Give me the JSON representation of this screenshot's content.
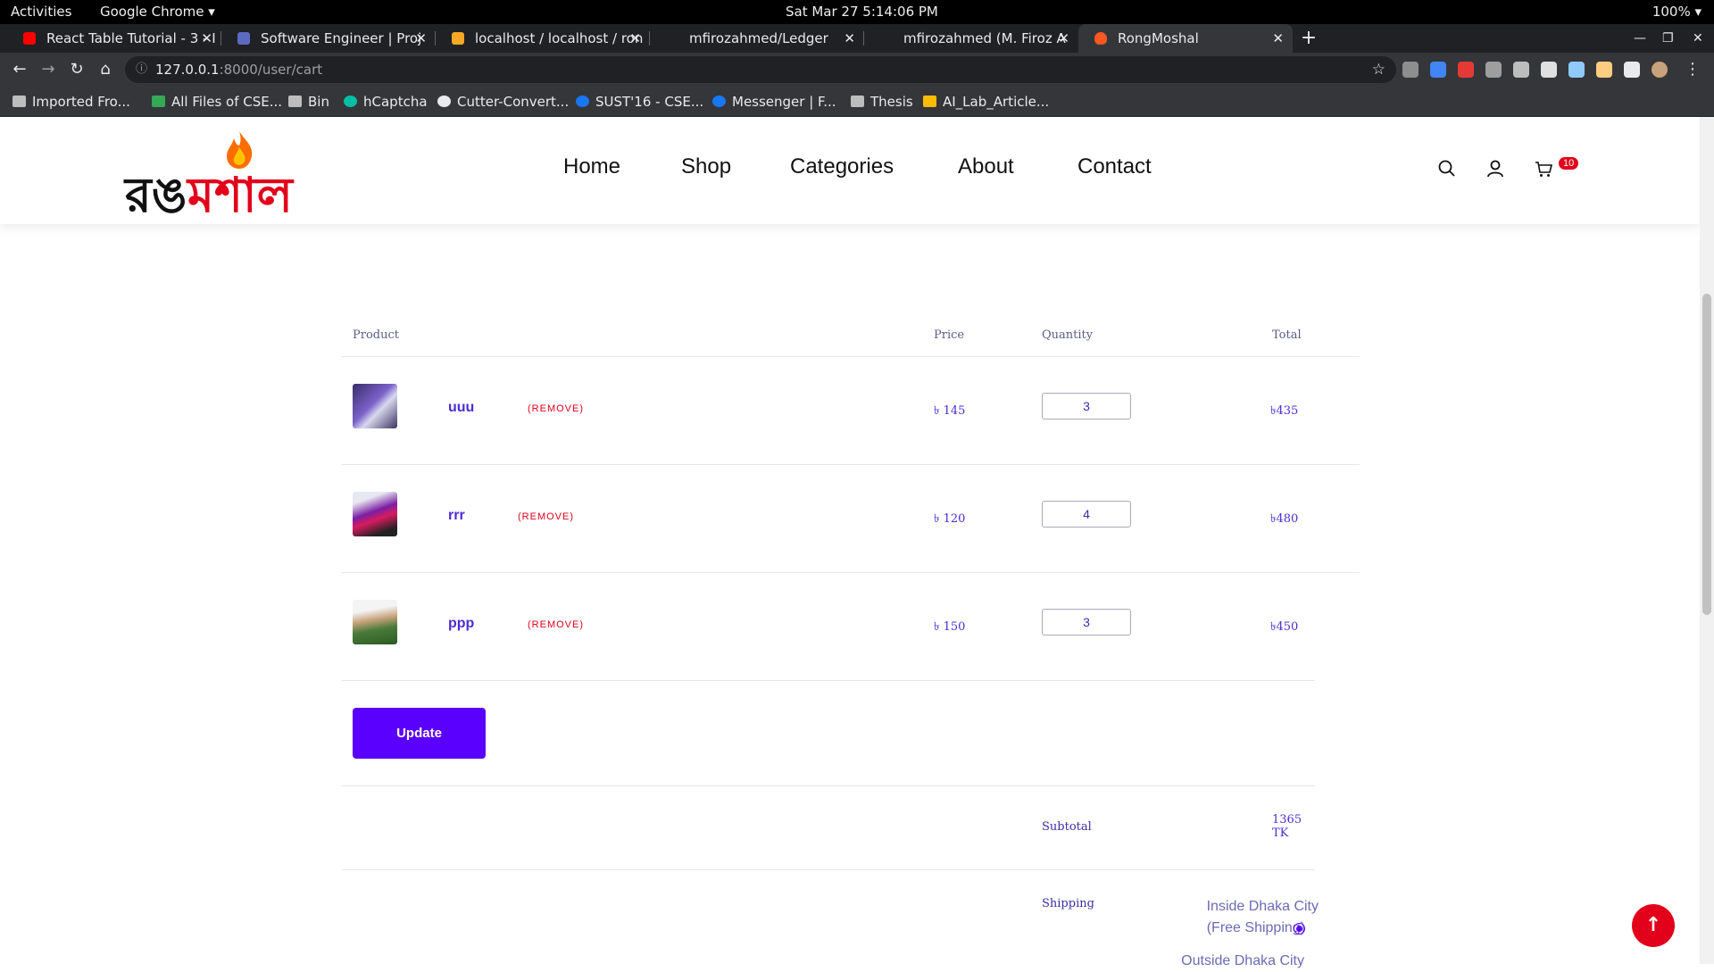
{
  "system_bar": {
    "activities": "Activities",
    "app_name": "Google Chrome ▾",
    "clock": "Sat Mar 27   5:14:06 PM",
    "status": "100% ▾"
  },
  "browser": {
    "tabs": [
      {
        "label": "React Table Tutorial - 3 - I",
        "favicon_color": "#ff0000"
      },
      {
        "label": "Software Engineer | Proj",
        "favicon_color": "#5c6bc0"
      },
      {
        "label": "localhost / localhost / ron",
        "favicon_color": "#f9a825"
      },
      {
        "label": "mfirozahmed/Ledger",
        "favicon_color": "#202124"
      },
      {
        "label": "mfirozahmed (M. Firoz A",
        "favicon_color": "#202124"
      },
      {
        "label": "RongMoshal",
        "favicon_color": "#ff5722"
      }
    ],
    "url_host": "127.0.0.1",
    "url_path": ":8000/user/cart",
    "bookmarks": [
      {
        "label": "Imported Fro...",
        "color": "#bdbdbd"
      },
      {
        "label": "All Files of CSE...",
        "color": "#34a853"
      },
      {
        "label": "Bin",
        "color": "#bdbdbd"
      },
      {
        "label": "hCaptcha",
        "color": "#00bfa5"
      },
      {
        "label": "Cutter-Convert...",
        "color": "#e8eaed"
      },
      {
        "label": "SUST'16 - CSE...",
        "color": "#1877f2"
      },
      {
        "label": "Messenger | F...",
        "color": "#1877f2"
      },
      {
        "label": "Thesis",
        "color": "#bdbdbd"
      },
      {
        "label": "AI_Lab_Article...",
        "color": "#fbbc04"
      }
    ]
  },
  "site": {
    "logo_text_black": "রঙ",
    "logo_text_red": "মশাল",
    "nav": [
      "Home",
      "Shop",
      "Categories",
      "About",
      "Contact"
    ],
    "cart_count": "10",
    "accent_color": "#5a00ff",
    "brand_red": "#e2001a"
  },
  "cart": {
    "columns": {
      "product": "Product",
      "price": "Price",
      "quantity": "Quantity",
      "total": "Total"
    },
    "rows": [
      {
        "name": "uuu",
        "remove": "(REMOVE)",
        "price": "৳ 145",
        "quantity": "3",
        "total": "৳435"
      },
      {
        "name": "rrr",
        "remove": "(REMOVE)",
        "price": "৳ 120",
        "quantity": "4",
        "total": "৳480"
      },
      {
        "name": "ppp",
        "remove": "(REMOVE)",
        "price": "৳ 150",
        "quantity": "3",
        "total": "৳450"
      }
    ],
    "update_label": "Update",
    "subtotal_label": "Subtotal",
    "subtotal_value": "1365 TK",
    "shipping_label": "Shipping",
    "shipping_option_1_line1": "Inside Dhaka City",
    "shipping_option_1_line2": "(Free Shipping)",
    "shipping_option_2": "Outside Dhaka City"
  }
}
